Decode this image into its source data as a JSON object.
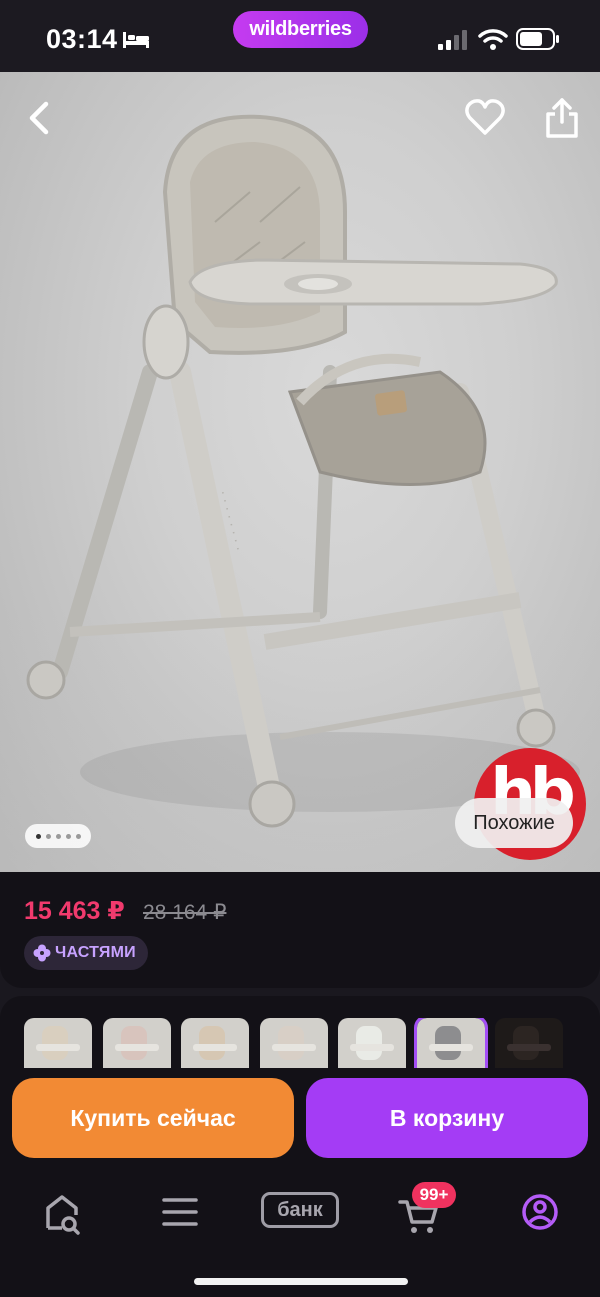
{
  "status_bar": {
    "time": "03:14",
    "brand": "wildberries",
    "icons": [
      "bed-icon",
      "signal-icon",
      "wifi-icon",
      "battery-icon"
    ]
  },
  "hero": {
    "image_description_icon": "high-chair-product-photo",
    "carousel": {
      "current": 1,
      "total": 5
    },
    "similar_label": "Похожие",
    "brand_badge": "hb",
    "icons": [
      "back-icon",
      "heart-icon",
      "share-icon"
    ]
  },
  "pricing": {
    "price": "15 463 ₽",
    "old_price": "28 164 ₽",
    "installments_label": "ЧАСТЯМИ"
  },
  "variants": {
    "selected_index": 5,
    "count_visible": 7,
    "tints": [
      "#d9cfbf",
      "#d8c4bd",
      "#d6c7b3",
      "#d8cfc6",
      "#e9ebe6",
      "#8d8d8f",
      "#2c2522"
    ]
  },
  "actions": {
    "buy_now": "Купить сейчас",
    "add_to_cart": "В корзину"
  },
  "nav": {
    "bank_label": "банк",
    "cart_badge": "99+",
    "icons": [
      "home-search-icon",
      "menu-icon",
      "bank-icon",
      "cart-icon",
      "profile-icon"
    ]
  },
  "colors": {
    "accent_purple": "#a43cf5",
    "accent_orange": "#f28a34",
    "price_pink": "#f13a6d",
    "background": "#1a181f"
  }
}
